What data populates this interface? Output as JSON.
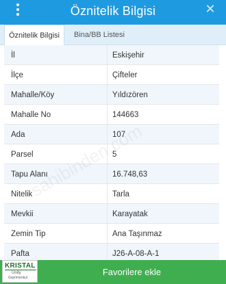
{
  "dialog": {
    "title": "Öznitelik Bilgisi",
    "close_glyph": "✕"
  },
  "tabs": [
    {
      "label": "Öznitelik Bilgisi",
      "active": true
    },
    {
      "label": "Bina/BB Listesi",
      "active": false
    }
  ],
  "rows": [
    {
      "key": "İl",
      "value": "Eskişehir"
    },
    {
      "key": "İlçe",
      "value": "Çifteler"
    },
    {
      "key": "Mahalle/Köy",
      "value": "Yıldızören"
    },
    {
      "key": "Mahalle No",
      "value": "144663"
    },
    {
      "key": "Ada",
      "value": "107"
    },
    {
      "key": "Parsel",
      "value": "5"
    },
    {
      "key": "Tapu Alanı",
      "value": "16.748,63"
    },
    {
      "key": "Nitelik",
      "value": "Tarla"
    },
    {
      "key": "Mevkii",
      "value": "Karayatak"
    },
    {
      "key": "Zemin Tip",
      "value": "Ana Taşınmaz"
    },
    {
      "key": "Pafta",
      "value": "J26-A-08-A-1"
    }
  ],
  "watermark": "sahibinden.com",
  "bottom": {
    "favorite_label": "Favorilere ekle"
  },
  "logo": {
    "line1": "KRISTAL",
    "line2": "Unity",
    "line3": "Gayrimenkul"
  },
  "colors": {
    "titlebar": "#1e9be0",
    "bottombar": "#3fae4f"
  }
}
